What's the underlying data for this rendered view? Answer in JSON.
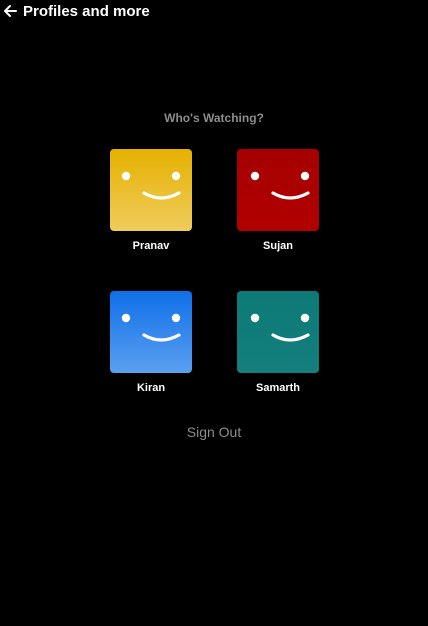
{
  "header": {
    "back_icon": "arrow-left-icon",
    "title": "Profiles and more"
  },
  "main": {
    "heading": "Who's Watching?",
    "profiles": [
      {
        "name": "Pranav",
        "color_top": "#e5b100",
        "color_bottom": "#f0cc5c",
        "icon": "smiley-face-icon"
      },
      {
        "name": "Sujan",
        "color_top": "#a60000",
        "color_bottom": "#b10000",
        "icon": "smiley-face-icon"
      },
      {
        "name": "Kiran",
        "color_top": "#0f6fe8",
        "color_bottom": "#5aa0f0",
        "icon": "smiley-face-icon"
      },
      {
        "name": "Samarth",
        "color_top": "#0d7a78",
        "color_bottom": "#147f7c",
        "icon": "smiley-face-icon"
      }
    ],
    "sign_out_label": "Sign Out"
  },
  "colors": {
    "background": "#000000",
    "muted_text": "#8c8c8c"
  }
}
